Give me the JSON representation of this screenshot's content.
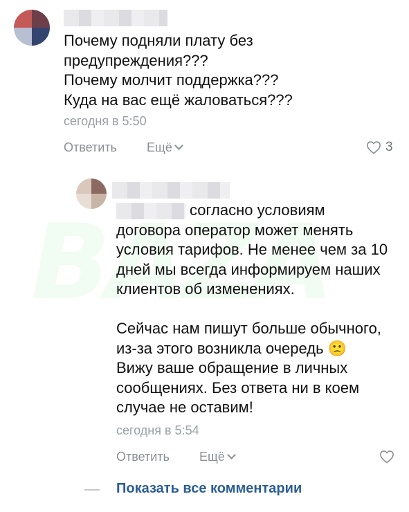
{
  "comment": {
    "lines": [
      "Почему подняли плату без",
      "предупреждения???",
      "Почему молчит поддержка???",
      "Куда на вас ещё жаловаться???"
    ],
    "time": "сегодня в 5:50",
    "reply_label": "Ответить",
    "more_label": "Ещё",
    "likes": "3"
  },
  "reply": {
    "lines": [
      "согласно условиям",
      "договора оператор может менять",
      "условия тарифов. Не менее чем за 10",
      "дней мы всегда информируем наших",
      "клиентов об изменениях.",
      "",
      "Сейчас нам пишут больше обычного,",
      "из-за этого возникла очередь",
      "Вижу ваше обращение в личных",
      "сообщениях. Без ответа ни в коем",
      "случае не оставим!"
    ],
    "emoji": "🙁",
    "time": "сегодня в 5:54",
    "reply_label": "Ответить",
    "more_label": "Ещё"
  },
  "footer": {
    "show_all_label": "Показать все комментарии"
  },
  "icons": {
    "heart": "heart-outline-icon",
    "chevron": "chevron-down-icon"
  },
  "colors": {
    "link": "#2a5d96",
    "meta": "#9a9ea5",
    "text": "#111111"
  }
}
